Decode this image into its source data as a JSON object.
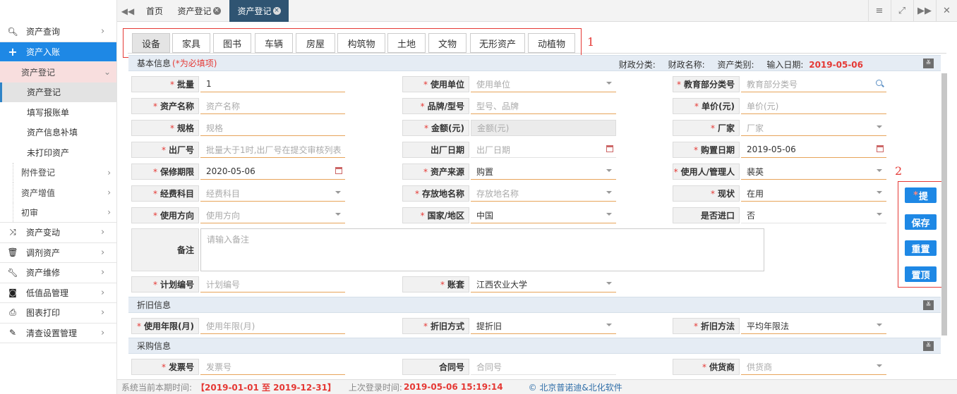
{
  "sidebar": {
    "items": [
      {
        "label": "资产查询",
        "icon": "search-icon"
      },
      {
        "label": "资产入账",
        "icon": "plus-icon"
      },
      {
        "label": "资产登记"
      },
      {
        "label": "资产登记"
      },
      {
        "label": "填写报账单"
      },
      {
        "label": "资产信息补填"
      },
      {
        "label": "未打印资产"
      },
      {
        "label": "附件登记"
      },
      {
        "label": "资产增值"
      },
      {
        "label": "初审"
      },
      {
        "label": "资产变动",
        "icon": "shuffle-icon"
      },
      {
        "label": "调剂资产",
        "icon": "trash-icon"
      },
      {
        "label": "资产维修",
        "icon": "wrench-icon"
      },
      {
        "label": "低值品管理",
        "icon": "money-icon"
      },
      {
        "label": "图表打印",
        "icon": "print-icon"
      },
      {
        "label": "清查设置管理",
        "icon": "edit-icon"
      }
    ]
  },
  "tabs": [
    {
      "label": "首页"
    },
    {
      "label": "资产登记"
    },
    {
      "label": "资产登记"
    }
  ],
  "categories": [
    "设备",
    "家具",
    "图书",
    "车辆",
    "房屋",
    "构筑物",
    "土地",
    "文物",
    "无形资产",
    "动植物"
  ],
  "annotations": {
    "one": "1",
    "two": "2"
  },
  "basic": {
    "title": "基本信息",
    "required_note": "(*为必填项)",
    "meta": {
      "finance_class": "财政分类:",
      "finance_name": "财政名称:",
      "asset_type": "资产类别:",
      "input_date_label": "输入日期:",
      "input_date": "2019-05-06"
    }
  },
  "fields": {
    "batch": {
      "label": "批量",
      "value": "1"
    },
    "unit": {
      "label": "使用单位",
      "placeholder": "使用单位"
    },
    "edu_class": {
      "label": "教育部分类号",
      "placeholder": "教育部分类号"
    },
    "name": {
      "label": "资产名称",
      "placeholder": "资产名称"
    },
    "brand": {
      "label": "品牌/型号",
      "placeholder": "型号、品牌"
    },
    "price": {
      "label": "单价(元)",
      "placeholder": "单价(元)"
    },
    "spec": {
      "label": "规格",
      "placeholder": "规格"
    },
    "amount": {
      "label": "金额(元)",
      "placeholder": "金额(元)"
    },
    "maker": {
      "label": "厂家",
      "placeholder": "厂家"
    },
    "serial": {
      "label": "出厂号",
      "placeholder": "批量大于1时,出厂号在提交审核列表"
    },
    "mfg_date": {
      "label": "出厂日期",
      "placeholder": "出厂日期"
    },
    "buy_date": {
      "label": "购置日期",
      "value": "2019-05-06"
    },
    "warranty": {
      "label": "保修期限",
      "value": "2020-05-06"
    },
    "source": {
      "label": "资产来源",
      "value": "购置"
    },
    "user": {
      "label": "使用人/管理人",
      "value": "裴英"
    },
    "fund": {
      "label": "经费科目",
      "placeholder": "经费科目"
    },
    "location": {
      "label": "存放地名称",
      "placeholder": "存放地名称"
    },
    "status": {
      "label": "现状",
      "value": "在用"
    },
    "direction": {
      "label": "使用方向",
      "placeholder": "使用方向"
    },
    "country": {
      "label": "国家/地区",
      "value": "中国"
    },
    "imported": {
      "label": "是否进口",
      "value": "否"
    },
    "remark": {
      "label": "备注",
      "placeholder": "请输入备注"
    },
    "plan": {
      "label": "计划编号",
      "placeholder": "计划编号"
    },
    "account": {
      "label": "账套",
      "value": "江西农业大学"
    }
  },
  "depreciation": {
    "title": "折旧信息",
    "years": {
      "label": "使用年限(月)",
      "placeholder": "使用年限(月)"
    },
    "mode": {
      "label": "折旧方式",
      "value": "提折旧"
    },
    "method": {
      "label": "折旧方法",
      "value": "平均年限法"
    }
  },
  "purchase": {
    "title": "采购信息",
    "invoice": {
      "label": "发票号",
      "placeholder": "发票号"
    },
    "contract": {
      "label": "合同号",
      "placeholder": "合同号"
    },
    "supplier": {
      "label": "供货商",
      "placeholder": "供货商"
    }
  },
  "buttons": {
    "submit": "提",
    "save": "保存",
    "reset": "重置",
    "top": "置顶"
  },
  "footer": {
    "period_label": "系统当前本期时间:",
    "period": "【2019-01-01 至 2019-12-31】",
    "last_login_label": "上次登录时间:",
    "last_login": "2019-05-06 15:19:14",
    "copyright": "© 北京普诺迪&北化软件"
  },
  "colors": {
    "accent": "#1e88e5",
    "active_tab": "#2f5472",
    "required": "#e53935",
    "section_bg": "#e5ecf4"
  }
}
